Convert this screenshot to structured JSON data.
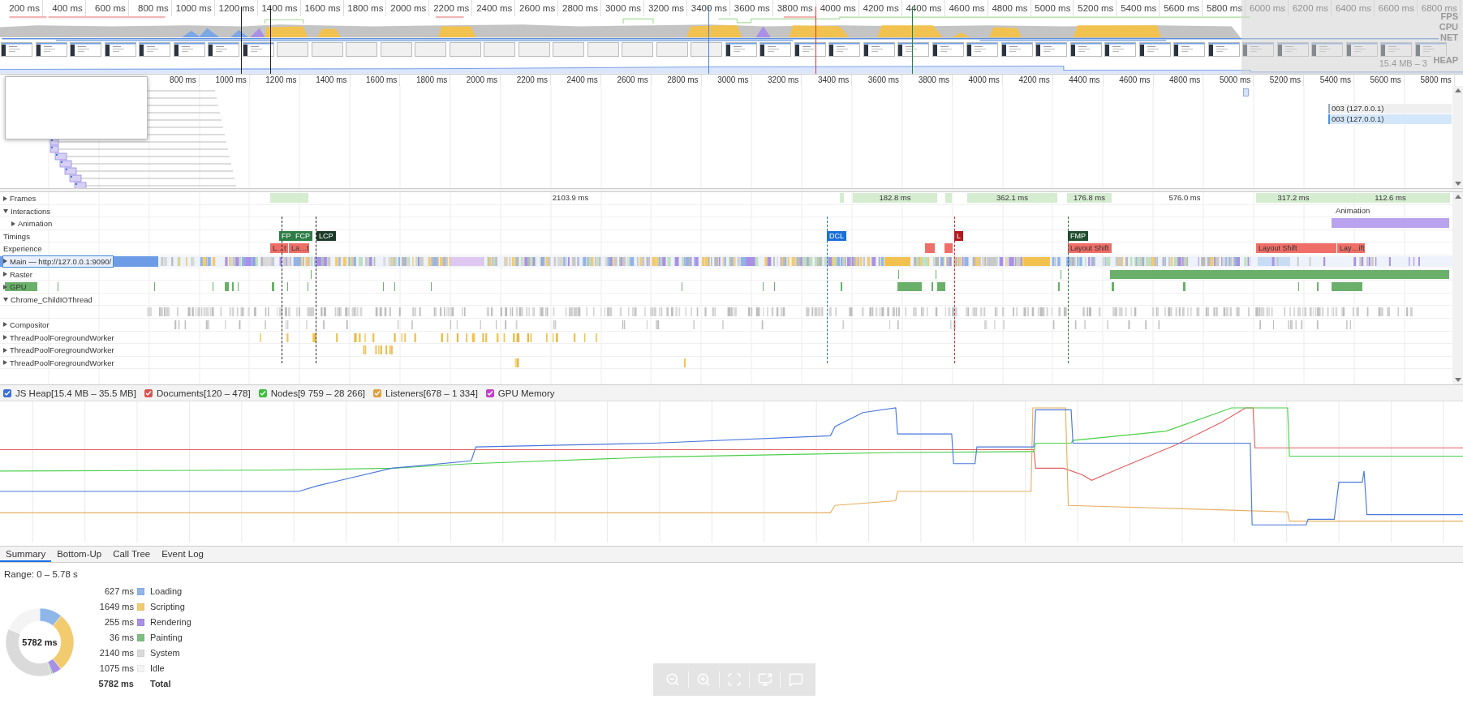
{
  "overview": {
    "ruler": [
      "200 ms",
      "400 ms",
      "600 ms",
      "800 ms",
      "1000 ms",
      "1200 ms",
      "1400 ms",
      "1600 ms",
      "1800 ms",
      "2000 ms",
      "2200 ms",
      "2400 ms",
      "2600 ms",
      "2800 ms",
      "3000 ms",
      "3200 ms",
      "3400 ms",
      "3600 ms",
      "3800 ms",
      "4000 ms",
      "4200 ms",
      "4400 ms",
      "4600 ms",
      "4800 ms",
      "5000 ms",
      "5200 ms",
      "5400 ms",
      "5600 ms",
      "5800 ms",
      "6000 ms",
      "6200 ms",
      "6400 ms",
      "6600 ms",
      "6800 ms"
    ],
    "tracks": [
      "FPS",
      "CPU",
      "NET",
      "HEAP"
    ],
    "heap_range": "15.4 MB – 3"
  },
  "network": {
    "ruler": [
      "800 ms",
      "1000 ms",
      "1200 ms",
      "1400 ms",
      "1600 ms",
      "1800 ms",
      "2000 ms",
      "2200 ms",
      "2400 ms",
      "2600 ms",
      "2800 ms",
      "3000 ms",
      "3200 ms",
      "3400 ms",
      "3600 ms",
      "3800 ms",
      "4000 ms",
      "4200 ms",
      "4400 ms",
      "4600 ms",
      "4800 ms",
      "5000 ms",
      "5200 ms",
      "5400 ms",
      "5600 ms",
      "5800 ms"
    ],
    "requests": [
      {
        "label": "003 (127.0.0.1)",
        "selected": false
      },
      {
        "label": "003 (127.0.0.1)",
        "selected": true
      }
    ]
  },
  "tracks": [
    {
      "label": "Frames",
      "kind": "frames",
      "expanded": false
    },
    {
      "label": "Interactions",
      "kind": "group",
      "expanded": true,
      "children": [
        {
          "label": "Animation",
          "kind": "animation",
          "expanded": false
        }
      ]
    },
    {
      "label": "Timings",
      "kind": "timings"
    },
    {
      "label": "Experience",
      "kind": "experience"
    },
    {
      "label": "Main — http://127.0.0.1:9090/",
      "kind": "main",
      "expanded": false,
      "selected": true
    },
    {
      "label": "Raster",
      "kind": "raster",
      "expanded": false,
      "selected": false
    },
    {
      "label": "GPU",
      "kind": "gpu",
      "expanded": false,
      "selected": false
    },
    {
      "label": "Chrome_ChildIOThread",
      "kind": "io",
      "expanded": true,
      "selected": false
    },
    {
      "label": "Compositor",
      "kind": "compositor",
      "expanded": false,
      "selected": false
    },
    {
      "label": "ThreadPoolForegroundWorker",
      "kind": "worker",
      "expanded": false,
      "selected": false
    },
    {
      "label": "ThreadPoolForegroundWorker",
      "kind": "worker",
      "expanded": false,
      "selected": false
    },
    {
      "label": "ThreadPoolForegroundWorker",
      "kind": "worker",
      "expanded": false,
      "selected": false
    }
  ],
  "frames": [
    "2103.9 ms",
    "182.8 ms",
    "362.1 ms",
    "176.8 ms",
    "576.0 ms",
    "317.2 ms",
    "112.6 ms"
  ],
  "animation_label": "Animation",
  "timings": [
    {
      "label": "FP",
      "color": "#2d7d46"
    },
    {
      "label": "FCP",
      "color": "#2d7d46"
    },
    {
      "label": "LCP",
      "color": "#1b3a28"
    },
    {
      "label": "DCL",
      "color": "#1a6fd9"
    },
    {
      "label": "L",
      "color": "#b3181c"
    },
    {
      "label": "FMP",
      "color": "#1f4d2f"
    }
  ],
  "experience": [
    "L…t",
    "La…t",
    "Layout Shift",
    "Layout Shift",
    "Lay…ift"
  ],
  "memory": {
    "counters": [
      {
        "label": "JS Heap[15.4 MB – 35.5 MB]",
        "checked": true,
        "color": "#3a6fd8"
      },
      {
        "label": "Documents[120 – 478]",
        "checked": true,
        "color": "#d9534f"
      },
      {
        "label": "Nodes[9 759 – 28 266]",
        "checked": true,
        "color": "#3bbf3b"
      },
      {
        "label": "Listeners[678 – 1 334]",
        "checked": true,
        "color": "#e0a040"
      },
      {
        "label": "GPU Memory",
        "checked": true,
        "color": "#c040c8"
      }
    ]
  },
  "tabs": [
    {
      "label": "Summary",
      "selected": true
    },
    {
      "label": "Bottom-Up",
      "selected": false
    },
    {
      "label": "Call Tree",
      "selected": false
    },
    {
      "label": "Event Log",
      "selected": false
    }
  ],
  "summary": {
    "range": "Range: 0 – 5.78 s",
    "center_label": "5782 ms",
    "chart_data": {
      "type": "donut",
      "categories": [
        "Loading",
        "Scripting",
        "Rendering",
        "Painting",
        "System",
        "Idle"
      ],
      "series": [
        {
          "values": [
            10.84,
            28.52,
            4.41,
            0.62,
            37.01,
            18.6
          ]
        }
      ]
    },
    "legend": [
      {
        "value": "627 ms",
        "color": "#8fb6e8"
      },
      {
        "value": "1649 ms",
        "color": "#f2cb6e"
      },
      {
        "value": "255 ms",
        "color": "#a98fe6"
      },
      {
        "value": "36 ms",
        "color": "#80bf80"
      },
      {
        "value": "2140 ms",
        "color": "#dadada"
      },
      {
        "value": "1075 ms",
        "color": "#f4f4f4"
      }
    ],
    "total": {
      "value": "5782 ms",
      "label": "Total"
    }
  }
}
